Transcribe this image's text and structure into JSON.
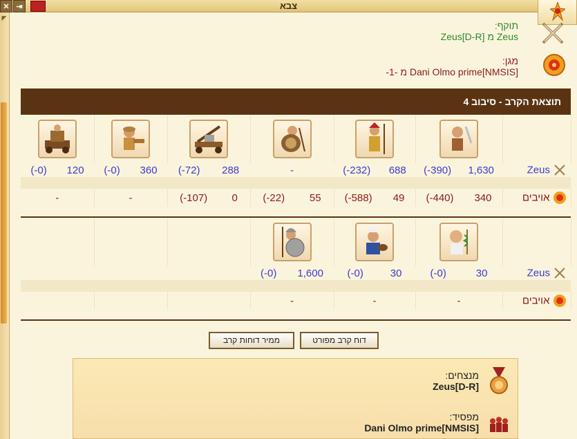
{
  "window": {
    "title": "צבא"
  },
  "attacker": {
    "label": "תוקף:",
    "value": "Zeus מ Zeus[D-R]"
  },
  "defender": {
    "label": "מגן:",
    "value": "Dani Olmo prime[NMSIS] מ -1-"
  },
  "result": {
    "title": "תוצאת הקרב - סיבוב 4"
  },
  "round1": {
    "our_label": "Zeus",
    "enemy_label": "אויבים",
    "units": [
      "swordsman-icon",
      "hoplite-icon",
      "shield-bearer-icon",
      "catapult-icon",
      "slinger-icon",
      "ram-icon"
    ],
    "our": [
      {
        "count": "1,630",
        "loss": "(-390)"
      },
      {
        "count": "688",
        "loss": "(-232)"
      },
      {
        "count": "-",
        "loss": ""
      },
      {
        "count": "288",
        "loss": "(-72)"
      },
      {
        "count": "360",
        "loss": "(-0)"
      },
      {
        "count": "120",
        "loss": "(-0)"
      }
    ],
    "enemy": [
      {
        "count": "340",
        "loss": "(-440)"
      },
      {
        "count": "49",
        "loss": "(-588)"
      },
      {
        "count": "55",
        "loss": "(-22)"
      },
      {
        "count": "0",
        "loss": "(-107)"
      },
      {
        "count": "-",
        "loss": ""
      },
      {
        "count": "-",
        "loss": ""
      }
    ]
  },
  "round2": {
    "our_label": "Zeus",
    "enemy_label": "אויבים",
    "units": [
      "doctor-icon",
      "cook-icon",
      "phalanx-icon"
    ],
    "our": [
      {
        "count": "30",
        "loss": "(-0)"
      },
      {
        "count": "30",
        "loss": "(-0)"
      },
      {
        "count": "1,600",
        "loss": "(-0)"
      }
    ],
    "enemy": [
      {
        "count": "-",
        "loss": ""
      },
      {
        "count": "-",
        "loss": ""
      },
      {
        "count": "-",
        "loss": ""
      }
    ]
  },
  "buttons": {
    "detailed": "דוח קרב מפורט",
    "converter": "ממיר דוחות קרב"
  },
  "summary": {
    "winners_label": "מנצחים:",
    "winners_value": "Zeus[D-R]",
    "losers_label": "מפסיד:",
    "losers_value": "Dani Olmo prime[NMSIS]"
  },
  "colors": {
    "header_bg": "#5a3412",
    "our": "#3b3bd0",
    "enemy": "#8a1a1a",
    "attacker": "#2a8a2a"
  }
}
